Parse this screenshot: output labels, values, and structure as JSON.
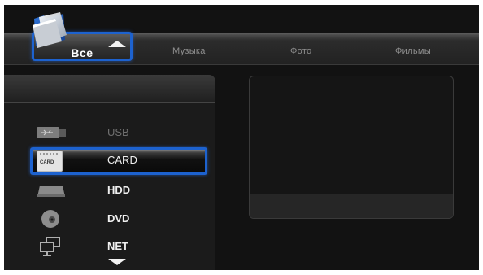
{
  "tabs": [
    {
      "label": "Все",
      "active": true
    },
    {
      "label": "Музыка",
      "active": false
    },
    {
      "label": "Фото",
      "active": false
    },
    {
      "label": "Фильмы",
      "active": false
    }
  ],
  "devices": [
    {
      "label": "USB",
      "icon": "usb-icon",
      "state": "disabled"
    },
    {
      "label": "CARD",
      "icon": "card-icon",
      "icon_text": "CARD",
      "state": "selected"
    },
    {
      "label": "HDD",
      "icon": "hdd-icon",
      "state": "normal"
    },
    {
      "label": "DVD",
      "icon": "dvd-icon",
      "state": "normal"
    },
    {
      "label": "NET",
      "icon": "network-icon",
      "state": "normal"
    }
  ],
  "colors": {
    "accent": "#1d62cf",
    "background": "#121212",
    "text": "#f0f0f0",
    "text_dim": "#6f6f6f"
  }
}
